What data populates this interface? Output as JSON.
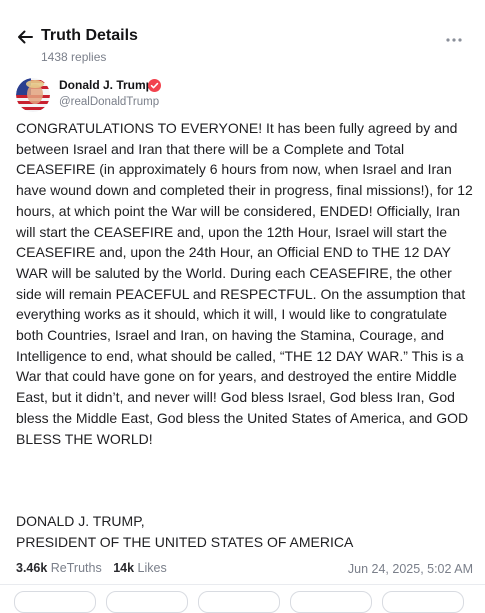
{
  "header": {
    "title": "Truth Details",
    "replies": "1438 replies",
    "back_icon": "arrow-left-icon",
    "more_icon": "more-horizontal-icon"
  },
  "author": {
    "name": "Donald J. Trump",
    "handle": "@realDonaldTrump",
    "verified_icon": "verified-badge-icon",
    "verified_color": "#f2434e",
    "avatar_icon": "avatar-image"
  },
  "post": {
    "body": "CONGRATULATIONS TO EVERYONE! It has been fully agreed by and between Israel and Iran that there will be a Complete and Total CEASEFIRE (in approximately 6 hours from now, when Israel and Iran have wound down and completed their in progress, final missions!), for 12 hours, at which point the War will be considered, ENDED! Officially, Iran will start the CEASEFIRE and, upon the 12th Hour, Israel will start the CEASEFIRE and, upon the 24th Hour, an Official END to THE 12 DAY WAR will be saluted by the World. During each CEASEFIRE, the other side will remain PEACEFUL and RESPECTFUL. On the assumption that everything works as it should, which it will, I would like to congratulate both Countries, Israel and Iran, on having the Stamina, Courage, and Intelligence to end, what should be called, “THE 12 DAY WAR.” This is a War that could have gone on for years, and destroyed the entire Middle East, but it didn’t, and never will! God bless Israel, God bless Iran, God bless the Middle East, God bless the United States of America, and GOD BLESS THE WORLD!",
    "signature_line1": "DONALD J. TRUMP,",
    "signature_line2": "PRESIDENT OF THE UNITED STATES OF AMERICA"
  },
  "stats": {
    "retruths_count": "3.46k",
    "retruths_label": "ReTruths",
    "likes_count": "14k",
    "likes_label": "Likes",
    "timestamp": "Jun 24, 2025, 5:02 AM"
  }
}
